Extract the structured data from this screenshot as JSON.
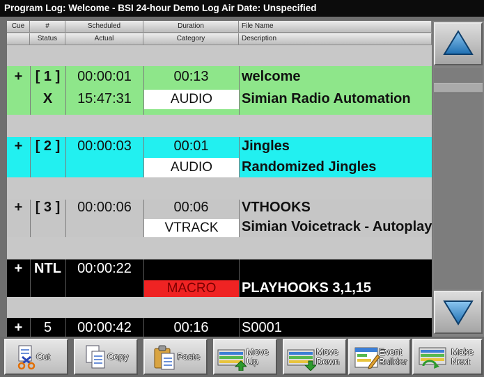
{
  "window": {
    "title": "Program Log: Welcome - BSI 24-hour Demo Log   Air Date: Unspecified"
  },
  "headers": {
    "row1": [
      "Cue",
      "#",
      "Scheduled",
      "Duration",
      "File Name"
    ],
    "row2": [
      "",
      "Status",
      "Actual",
      "Category",
      "Description"
    ]
  },
  "events": [
    {
      "cue": "+",
      "number": "[ 1 ]",
      "scheduled": "00:00:01",
      "duration": "00:13",
      "file_name": "welcome",
      "status": "X",
      "actual": "15:47:31",
      "category": "AUDIO",
      "description": "Simian Radio Automation",
      "bg": "#8ee68a",
      "text_color": "#111111"
    },
    {
      "cue": "+",
      "number": "[ 2 ]",
      "scheduled": "00:00:03",
      "duration": "00:01",
      "file_name": "Jingles",
      "status": "",
      "actual": "",
      "category": "AUDIO",
      "description": "Randomized Jingles",
      "bg": "#22f0f0",
      "text_color": "#111111"
    },
    {
      "cue": "+",
      "number": "[ 3 ]",
      "scheduled": "00:00:06",
      "duration": "00:06",
      "file_name": "VTHOOKS",
      "status": "",
      "actual": "",
      "category": "VTRACK",
      "description": "Simian Voicetrack - Autoplay",
      "bg": "#c6c6c6",
      "text_color": "#111111"
    },
    {
      "cue": "+",
      "number": "NTL",
      "scheduled": "00:00:22",
      "duration": "",
      "file_name": "",
      "status": "",
      "actual": "",
      "category": "MACRO",
      "description": "PLAYHOOKS 3,1,15",
      "bg": "#000000",
      "text_color": "#ffffff",
      "category_bg": "#ef2323",
      "category_color": "#7a0000"
    },
    {
      "cue": "+",
      "number": "5",
      "scheduled": "00:00:42",
      "duration": "00:16",
      "file_name": "S0001",
      "bg": "#000000",
      "text_color": "#ffffff"
    }
  ],
  "scrollbar": {
    "up_icon": "triangle-up-icon",
    "down_icon": "triangle-down-icon",
    "arrow_color": "#3b8fd0"
  },
  "toolbar": {
    "buttons": [
      {
        "label": "Cut",
        "icon": "scissors-icon"
      },
      {
        "label": "Copy",
        "icon": "copy-icon"
      },
      {
        "label": "Paste",
        "icon": "paste-icon"
      },
      {
        "label": "Move\nUp",
        "icon": "move-up-icon"
      },
      {
        "label": "Move\nDown",
        "icon": "move-down-icon"
      },
      {
        "label": "Event\nBuilder",
        "icon": "event-builder-icon"
      },
      {
        "label": "Make\nNext",
        "icon": "make-next-icon"
      }
    ]
  }
}
